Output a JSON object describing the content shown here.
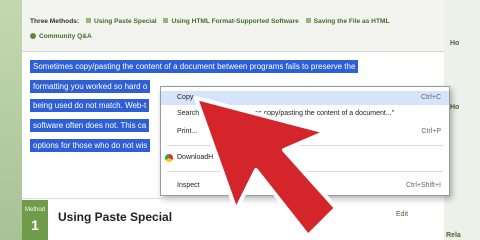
{
  "methods": {
    "label": "Three Methods:",
    "items": [
      "Using Paste Special",
      "Using HTML Format-Supported Software",
      "Saving the File as HTML"
    ],
    "community": "Community Q&A"
  },
  "body_lines": [
    "Sometimes copy/pasting the content of a document between programs fails to preserve the",
    "formatting you worked so hard o",
    "being used do not match. Web-t",
    "software often does not. This ca",
    "options for those who do not wis"
  ],
  "context_menu": {
    "copy": {
      "label": "Copy",
      "shortcut": "Ctrl+C"
    },
    "search": {
      "label": "Search",
      "tail": "times copy/pasting the content of a document...\""
    },
    "print": {
      "label": "Print...",
      "shortcut": "Ctrl+P"
    },
    "download": {
      "label": "DownloadH"
    },
    "inspect": {
      "label": "Inspect",
      "shortcut": "Ctrl+Shift+I"
    }
  },
  "method": {
    "badge_label": "Method",
    "badge_number": "1",
    "title": "Using Paste Special",
    "edit": "Edit"
  },
  "sidebar": {
    "word_top": "Ho",
    "word_mid": "Ho",
    "word_bottom": "Rela"
  },
  "colors": {
    "selection": "#2e5fd6",
    "accent_green": "#6e9c4a",
    "arrow_red": "#d4262a"
  }
}
